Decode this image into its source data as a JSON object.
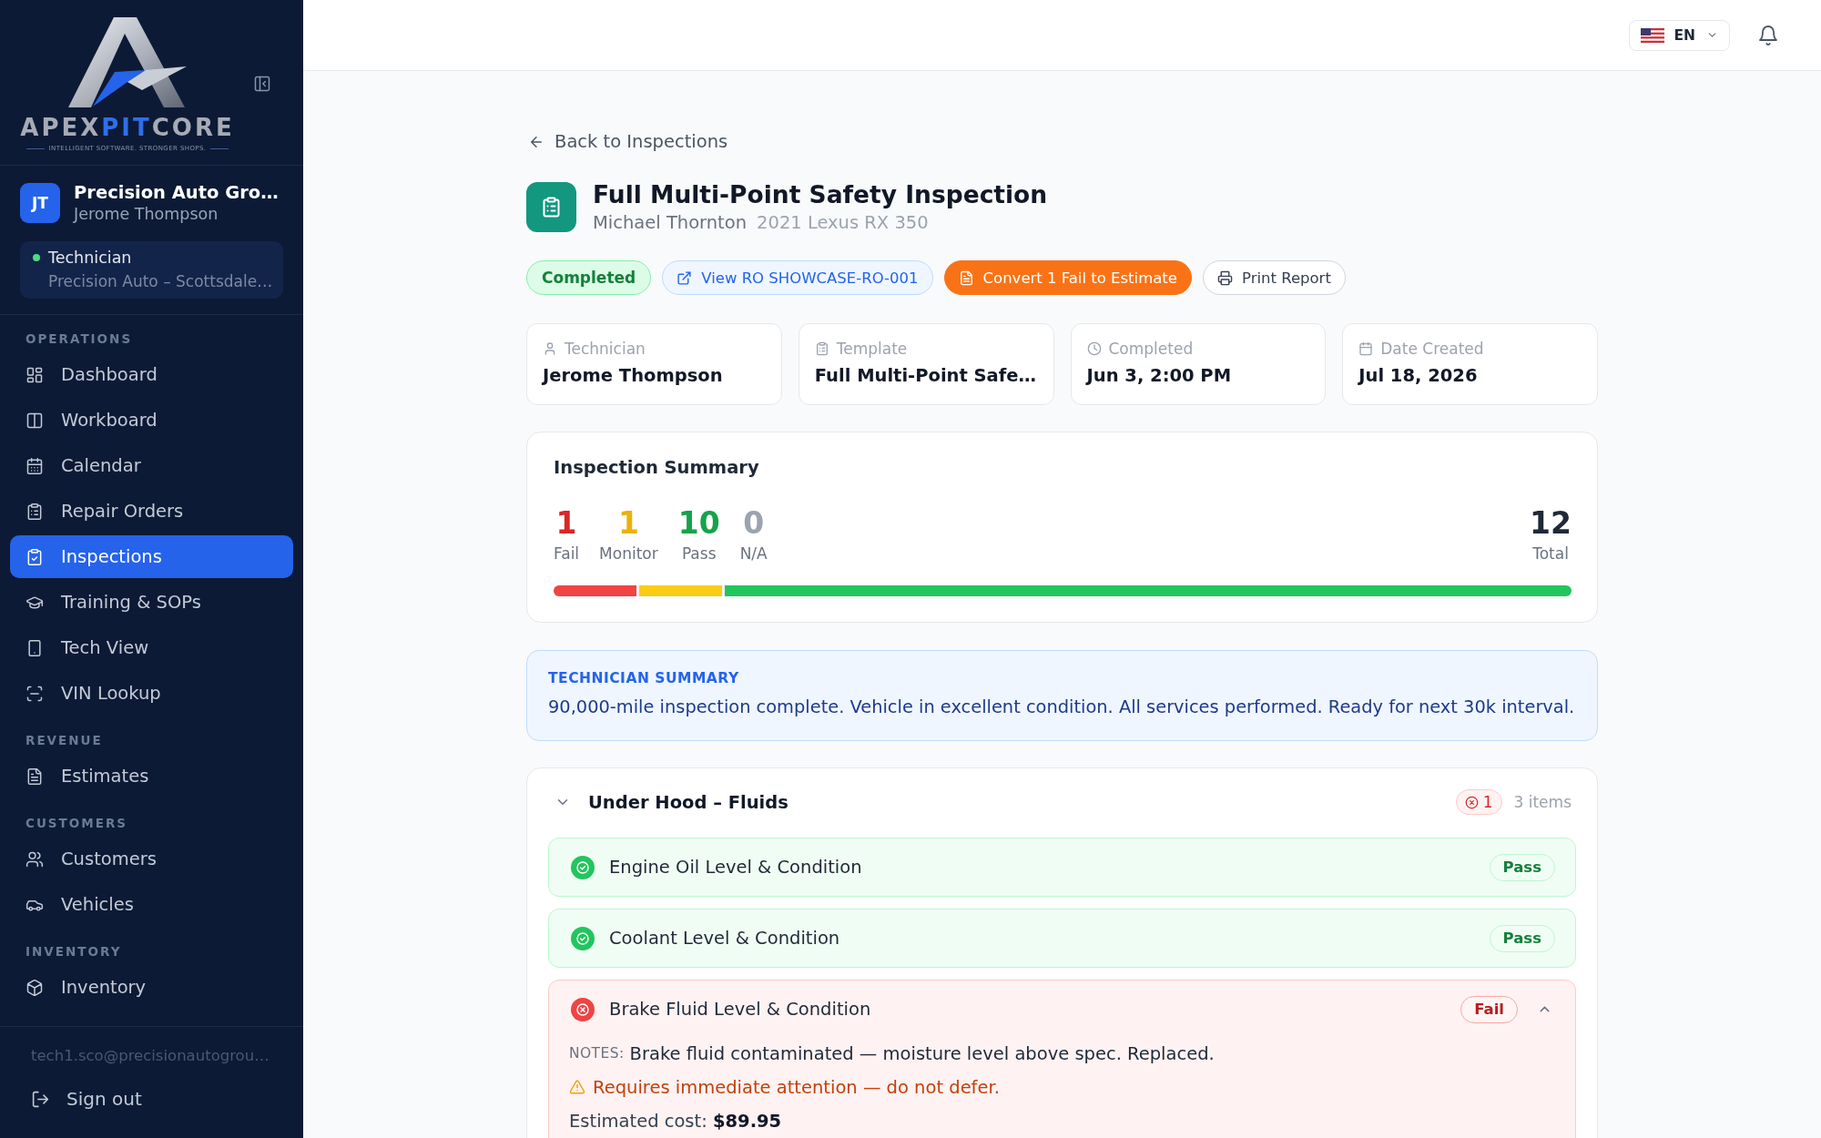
{
  "sidebar": {
    "logo": {
      "wordmark": [
        {
          "text": "APEX",
          "color": "#a6abb5"
        },
        {
          "text": "PIT",
          "color": "#2f6fe8"
        },
        {
          "text": "CORE",
          "color": "#a6abb5"
        }
      ],
      "tagline": "INTELLIGENT SOFTWARE. STRONGER SHOPS."
    },
    "account": {
      "initials": "JT",
      "organization": "Precision Auto Gro…",
      "user": "Jerome Thompson",
      "online": true,
      "role": "Technician",
      "location": "Precision Auto – Scottsdale…"
    },
    "sections": [
      {
        "heading": "OPERATIONS",
        "items": [
          {
            "label": "Dashboard",
            "selected": false
          },
          {
            "label": "Workboard",
            "selected": false
          },
          {
            "label": "Calendar",
            "selected": false
          },
          {
            "label": "Repair Orders",
            "selected": false
          },
          {
            "label": "Inspections",
            "selected": true
          },
          {
            "label": "Training & SOPs",
            "selected": false
          },
          {
            "label": "Tech View",
            "selected": false
          },
          {
            "label": "VIN Lookup",
            "selected": false
          }
        ]
      },
      {
        "heading": "REVENUE",
        "items": [
          {
            "label": "Estimates",
            "selected": false
          }
        ]
      },
      {
        "heading": "CUSTOMERS",
        "items": [
          {
            "label": "Customers",
            "selected": false
          },
          {
            "label": "Vehicles",
            "selected": false
          }
        ]
      },
      {
        "heading": "INVENTORY",
        "items": [
          {
            "label": "Inventory",
            "selected": false
          }
        ]
      }
    ],
    "email": "tech1.sco@precisionautogrou…",
    "sign_out": "Sign out"
  },
  "header": {
    "language": "EN"
  },
  "back_link": "Back to Inspections",
  "inspection": {
    "title": "Full Multi-Point Safety Inspection",
    "customer": "Michael Thornton",
    "vehicle": "2021 Lexus RX 350",
    "status": {
      "label": "Completed",
      "kind": "completed"
    },
    "actions": [
      {
        "kind": "link",
        "label": "View RO SHOWCASE-RO-001"
      },
      {
        "kind": "primary",
        "label": "Convert 1 Fail to Estimate"
      },
      {
        "kind": "outline",
        "label": "Print Report"
      }
    ]
  },
  "details": [
    {
      "label": "Technician",
      "value": "Jerome Thompson"
    },
    {
      "label": "Template",
      "value": "Full Multi-Point Safe…"
    },
    {
      "label": "Completed",
      "value": "Jun 3, 2:00 PM"
    },
    {
      "label": "Date Created",
      "value": "Jul 18, 2026"
    }
  ],
  "summary": {
    "title": "Inspection Summary",
    "counts": [
      {
        "kind": "fail",
        "value": "1",
        "label": "Fail"
      },
      {
        "kind": "monitor",
        "value": "1",
        "label": "Monitor"
      },
      {
        "kind": "pass",
        "value": "10",
        "label": "Pass"
      },
      {
        "kind": "na",
        "value": "0",
        "label": "N/A"
      }
    ],
    "total": {
      "value": "12",
      "label": "Total"
    },
    "bar": [
      {
        "kind": "fail",
        "level": 0.083
      },
      {
        "kind": "monitor",
        "level": 0.083
      },
      {
        "kind": "pass",
        "level": 0.834
      }
    ]
  },
  "technician_summary": {
    "heading": "TECHNICIAN SUMMARY",
    "text": "90,000-mile inspection complete. Vehicle in excellent condition. All services performed. Ready for next 30k interval."
  },
  "inspection_sections": [
    {
      "title": "Under Hood – Fluids",
      "expanded": true,
      "fail_count": "1",
      "item_count": "3 items",
      "items": [
        {
          "name": "Engine Oil Level & Condition",
          "kind": "pass",
          "result": "Pass",
          "expanded": false
        },
        {
          "name": "Coolant Level & Condition",
          "kind": "pass",
          "result": "Pass",
          "expanded": false
        },
        {
          "name": "Brake Fluid Level & Condition",
          "kind": "fail",
          "result": "Fail",
          "expanded": true,
          "notes_label": "NOTES:",
          "notes": "Brake fluid contaminated — moisture level above spec. Replaced.",
          "warning": "Requires immediate attention — do not defer.",
          "cost": "Estimated cost: **$89.95**"
        }
      ]
    }
  ]
}
